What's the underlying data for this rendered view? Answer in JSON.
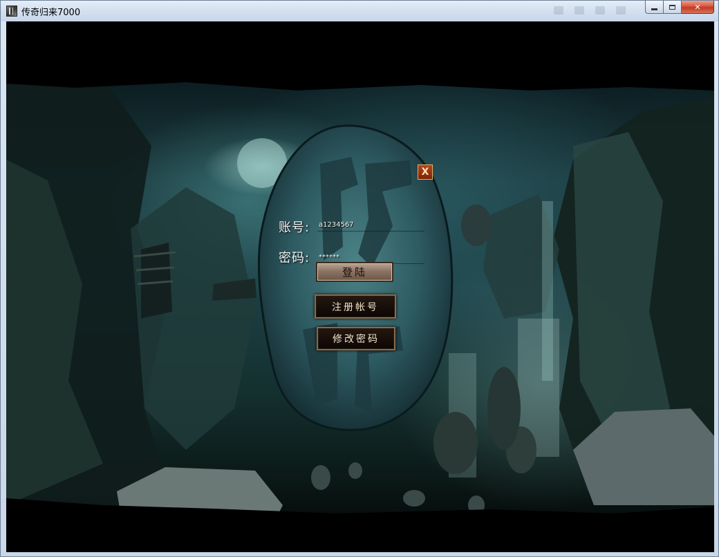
{
  "window": {
    "title": "传奇归来7000",
    "controls": {
      "minimize": "minimize",
      "maximize": "maximize",
      "close": "✕"
    }
  },
  "login": {
    "close_label": "X",
    "account_label": "账号:",
    "account_value": "a1234567",
    "password_label": "密码:",
    "password_value": "******",
    "login_button": "登陆",
    "register_button": "注册帐号",
    "change_password_button": "修改密码"
  },
  "icons": {
    "app": "game-app-icon",
    "close": "close-icon"
  },
  "colors": {
    "close_accent": "#b6441a",
    "stone": "#2f5a60",
    "button_border": "#8a6a4a"
  }
}
